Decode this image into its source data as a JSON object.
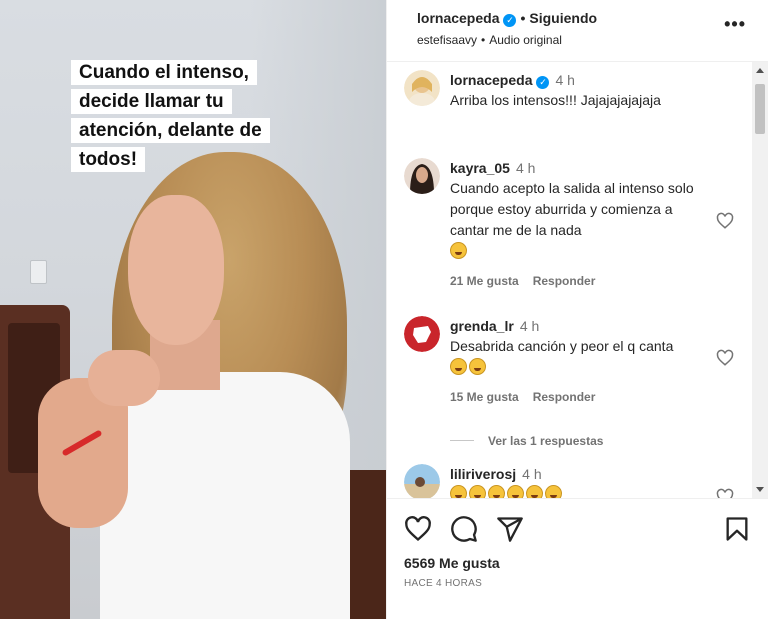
{
  "video": {
    "caption": "Cuando el intenso, decide llamar tu atención, delante de todos!"
  },
  "header": {
    "username": "lornacepeda",
    "separator": "•",
    "follow_state": "Siguiendo",
    "audio_user": "estefisaavy",
    "audio_sep": "•",
    "audio_label": "Audio original",
    "more_label": "•••"
  },
  "comments": [
    {
      "user": "lornacepeda",
      "time": "4 h",
      "text": "Arriba los intensos!!! Jajajajajajaja",
      "verified": true
    },
    {
      "user": "kayra_05",
      "time": "4 h",
      "text": "Cuando acepto la salida al intenso solo porque estoy aburrida y comienza a cantar me de la nada",
      "emoji_count": 1,
      "likes": "21 Me gusta",
      "reply": "Responder"
    },
    {
      "user": "grenda_lr",
      "time": "4 h",
      "text": "Desabrida canción y peor el q canta",
      "emoji_count": 2,
      "likes": "15 Me gusta",
      "reply": "Responder",
      "view_replies": "Ver las 1 respuestas"
    },
    {
      "user": "liliriverosj",
      "time": "4 h",
      "emoji_count": 6
    }
  ],
  "footer": {
    "likes": "6569 Me gusta",
    "time_ago": "HACE 4 HORAS"
  },
  "icons": [
    "heart-icon",
    "comment-icon",
    "share-icon",
    "bookmark-icon",
    "verified-icon",
    "more-icon"
  ],
  "colors": {
    "verified": "#0095f6",
    "secondary_text": "#737373",
    "primary_text": "#262626"
  }
}
